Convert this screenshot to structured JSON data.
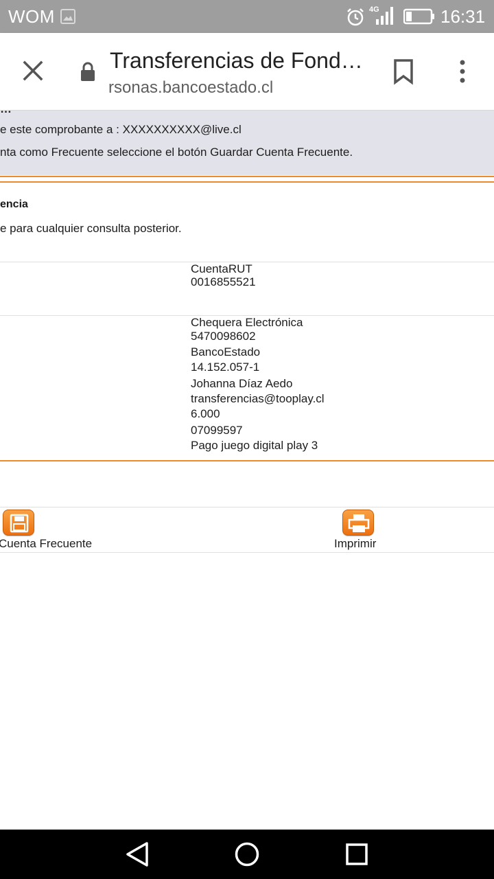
{
  "status_bar": {
    "carrier": "WOM",
    "network": "4G",
    "time": "16:31"
  },
  "browser": {
    "title": "Transferencias de Fond…",
    "url": "rsonas.bancoestado.cl"
  },
  "notice": {
    "line1": "e este comprobante a : XXXXXXXXXX@live.cl",
    "line2": "nta como Frecuente seleccione el botón Guardar Cuenta Frecuente."
  },
  "receipt": {
    "section_title": "encia",
    "section_note": "e para cualquier consulta posterior.",
    "origin": {
      "account_type": "CuentaRUT",
      "account_number": "0016855521"
    },
    "destination": {
      "account_type": "Chequera Electrónica",
      "account_number": "5470098602",
      "bank": "BancoEstado",
      "rut": "14.152.057-1",
      "name": "Johanna Díaz Aedo",
      "email": "transferencias@tooplay.cl",
      "amount": "6.000",
      "reference": "07099597",
      "message": "Pago juego digital play 3"
    }
  },
  "actions": {
    "save_label": "Cuenta Frecuente",
    "print_label": "Imprimir"
  },
  "icons": {
    "status": [
      "image-icon",
      "alarm-icon",
      "signal-icon",
      "battery-icon"
    ],
    "toolbar": [
      "close-icon",
      "lock-icon",
      "bookmark-icon",
      "more-vert-icon"
    ],
    "actions": [
      "save-disk-icon",
      "printer-icon"
    ],
    "nav": [
      "back-icon",
      "home-icon",
      "recents-icon"
    ]
  },
  "colors": {
    "accent_orange": "#ee8a2a",
    "notice_bg": "#e2e2ea",
    "status_bar": "#9e9e9e"
  }
}
